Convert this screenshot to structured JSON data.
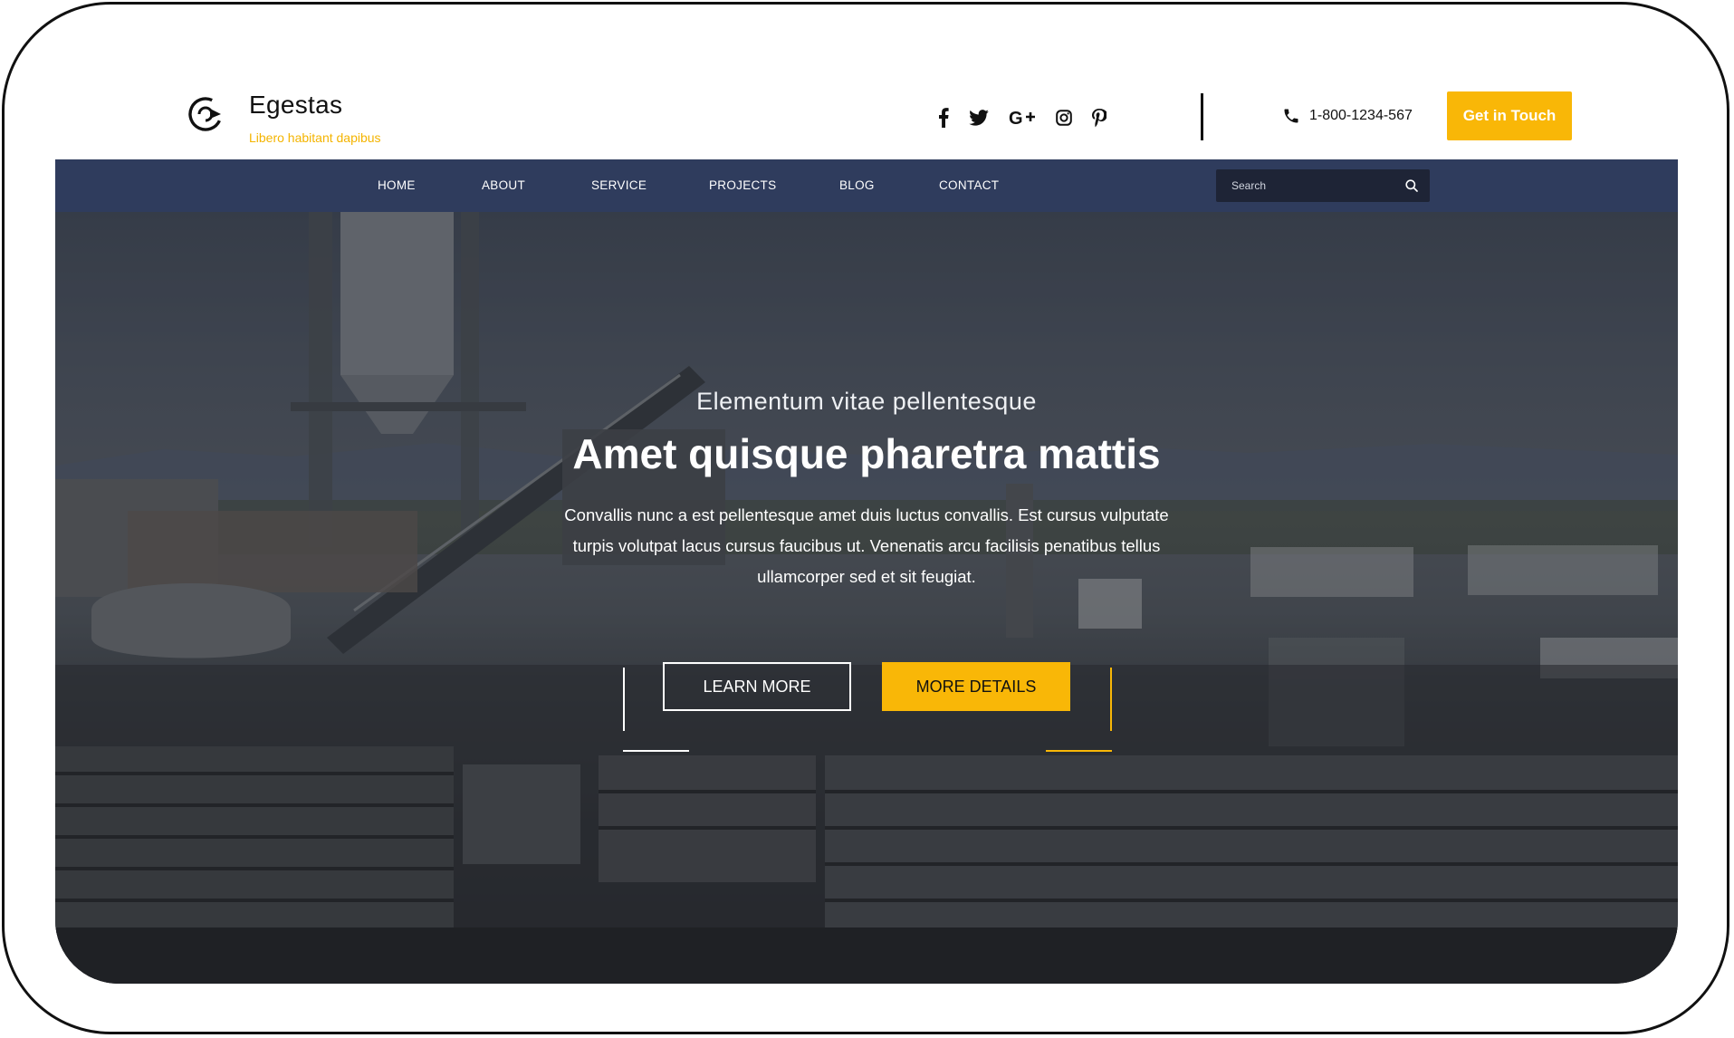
{
  "brand": {
    "name": "Egestas",
    "tagline": "Libero habitant dapibus",
    "logo_icon": "circular-arrow-logo-icon"
  },
  "socials": [
    {
      "name": "facebook-icon"
    },
    {
      "name": "twitter-icon"
    },
    {
      "name": "google-plus-icon"
    },
    {
      "name": "instagram-icon"
    },
    {
      "name": "pinterest-icon"
    }
  ],
  "contact": {
    "phone_icon": "phone-icon",
    "phone": "1-800-1234-567",
    "cta_label": "Get in Touch"
  },
  "nav": {
    "items": [
      "HOME",
      "ABOUT",
      "SERVICE",
      "PROJECTS",
      "BLOG",
      "CONTACT"
    ],
    "search_placeholder": "Search",
    "search_icon": "search-icon"
  },
  "hero": {
    "subtitle": "Elementum vitae pellentesque",
    "title": "Amet quisque pharetra mattis",
    "description": "Convallis nunc a est pellentesque amet duis luctus convallis. Est cursus vulputate turpis volutpat lacus cursus faucibus ut. Venenatis arcu facilisis penatibus tellus ullamcorper sed et sit feugiat.",
    "primary_button": "LEARN MORE",
    "secondary_button": "MORE DETAILS"
  },
  "colors": {
    "accent": "#F9B707",
    "tagline": "#F4B400",
    "nav_background": "#2F3C5D",
    "search_background": "#1E2436",
    "text_dark": "#111111"
  }
}
